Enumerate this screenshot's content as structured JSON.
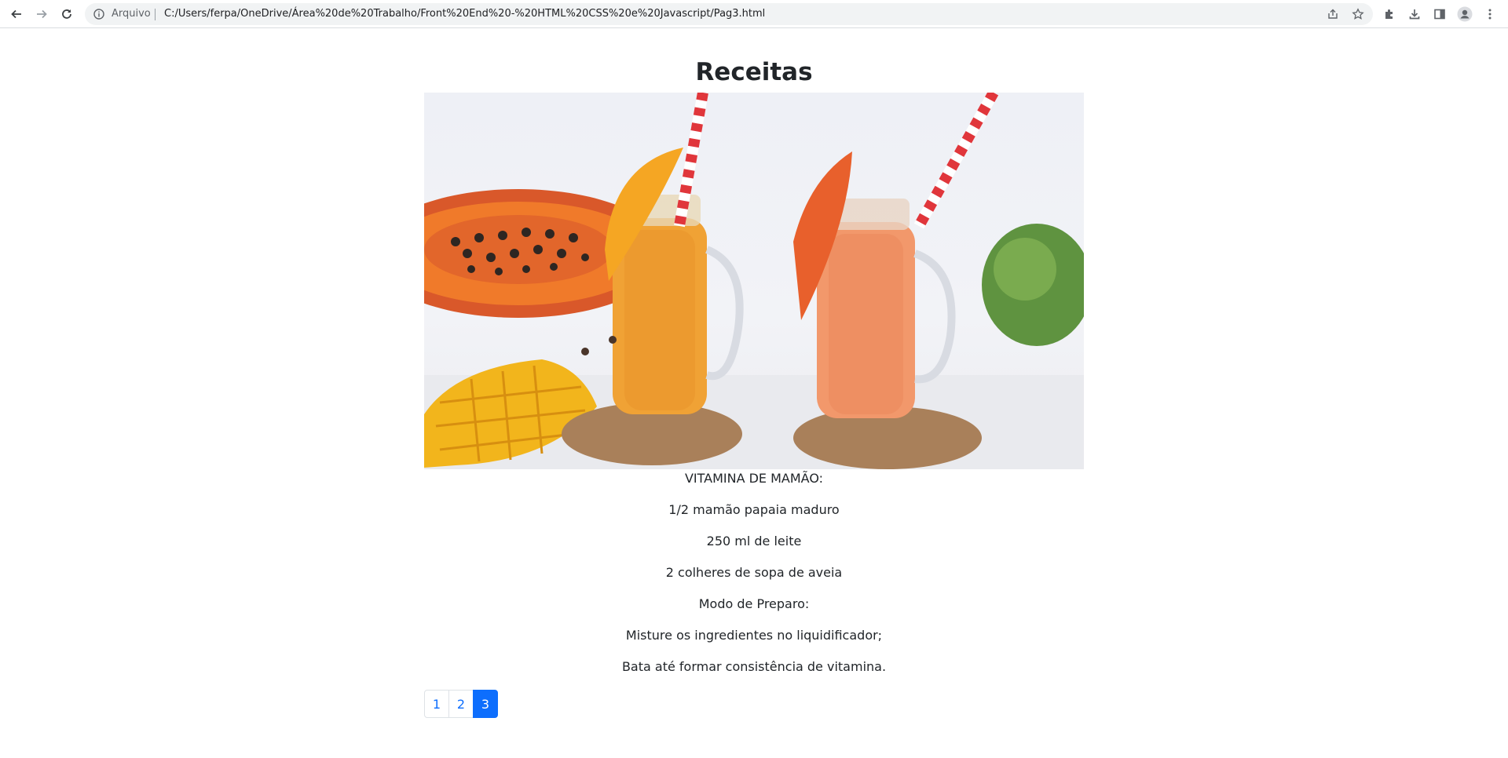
{
  "browser": {
    "security_label": "Arquivo",
    "url": "C:/Users/ferpa/OneDrive/Área%20de%20Trabalho/Front%20End%20-%20HTML%20CSS%20e%20Javascript/Pag3.html",
    "icons": [
      "back-arrow-icon",
      "forward-arrow-icon",
      "reload-icon",
      "info-icon",
      "share-icon",
      "star-icon",
      "extensions-icon",
      "download-icon",
      "side-panel-icon",
      "profile-icon",
      "menu-dots-icon"
    ]
  },
  "page": {
    "title": "Receitas",
    "image_subject": "papaya and mango smoothies in jars",
    "recipe": {
      "name": "VITAMINA DE MAMÃO:",
      "ingredients": [
        "1/2 mamão papaia maduro",
        "250 ml de leite",
        "2 colheres de sopa de aveia"
      ],
      "method_label": "Modo de Preparo:",
      "steps": [
        "Misture os ingredientes no liquidificador;",
        "Bata até formar consistência de vitamina."
      ]
    },
    "pagination": {
      "pages": [
        "1",
        "2",
        "3"
      ],
      "active_page": "3"
    }
  },
  "colors": {
    "accent": "#0d6efd",
    "text": "#212529",
    "border": "#dee2e6"
  }
}
